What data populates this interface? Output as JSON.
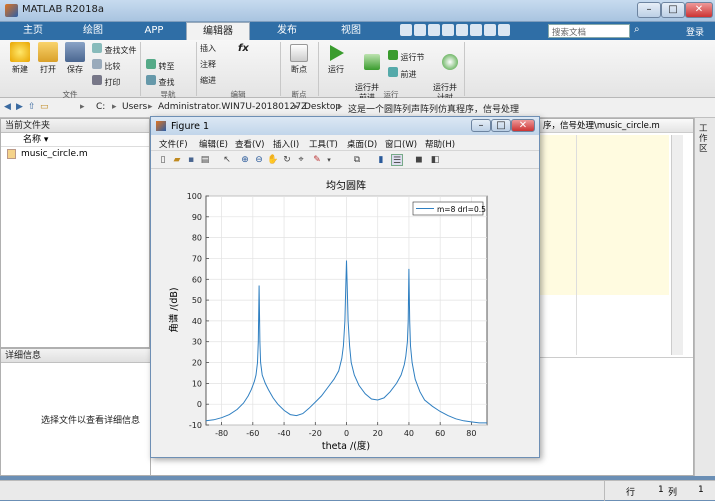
{
  "app": {
    "title": "MATLAB R2018a"
  },
  "tabs": [
    "主页",
    "绘图",
    "APP",
    "编辑器",
    "发布",
    "视图"
  ],
  "search": {
    "placeholder": "搜索文档"
  },
  "login_label": "登录",
  "ribbon": {
    "file": {
      "new": "新建",
      "open": "打开",
      "save": "保存",
      "find_files": "查找文件",
      "compare": "比较",
      "print": "打印",
      "group": "文件"
    },
    "nav": {
      "goto": "转至",
      "find": "查找",
      "group": "导航"
    },
    "edit": {
      "insert": "插入",
      "comment": "注释",
      "indent": "缩进",
      "fx": "fx",
      "group": "编辑"
    },
    "breakpoints": {
      "label": "断点",
      "group": "断点"
    },
    "run": {
      "run": "运行",
      "run_advance": "运行并\n前进",
      "run_section": "运行节",
      "advance": "前进",
      "run_time": "运行并\n计时",
      "group": "运行"
    }
  },
  "address": [
    "C:",
    "Users",
    "Administrator.WIN7U-20180127Z",
    "Desktop",
    "这是一个圆阵列声阵列仿真程序，信号处理"
  ],
  "current_folder": {
    "title": "当前文件夹",
    "col_name": "名称",
    "files": [
      "music_circle.m"
    ]
  },
  "details": {
    "title": "详细信息",
    "message": "选择文件以查看详细信息"
  },
  "editor_tab": "序，信号处理\\music_circle.m",
  "workspace_side": "工作区",
  "status": {
    "row_label": "行",
    "row": "1",
    "col_label": "列",
    "col": "1"
  },
  "figure": {
    "title": "Figure 1",
    "menu": [
      "文件(F)",
      "编辑(E)",
      "查看(V)",
      "插入(I)",
      "工具(T)",
      "桌面(D)",
      "窗口(W)",
      "帮助(H)"
    ]
  },
  "chart_data": {
    "type": "line",
    "title": "均匀圆阵",
    "xlabel": "theta /(度)",
    "ylabel": "角谱 /(dB)",
    "xlim": [
      -90,
      90
    ],
    "ylim": [
      -10,
      100
    ],
    "xticks": [
      -80,
      -60,
      -40,
      -20,
      0,
      20,
      40,
      60,
      80
    ],
    "yticks": [
      -10,
      0,
      10,
      20,
      30,
      40,
      50,
      60,
      70,
      80,
      90,
      100
    ],
    "grid": true,
    "legend_position": "top-right",
    "series": [
      {
        "name": "m=8 drl=0.5",
        "color": "#2f7fc1",
        "x": [
          -90,
          -85,
          -80,
          -75,
          -70,
          -66,
          -63,
          -61,
          -59,
          -58,
          -57,
          -56.5,
          -56,
          -55.5,
          -55,
          -54,
          -52,
          -50,
          -47,
          -44,
          -40,
          -36,
          -32,
          -28,
          -24,
          -20,
          -16,
          -12,
          -8,
          -5,
          -3,
          -2,
          -1,
          -0.5,
          0,
          0.5,
          1,
          2,
          3,
          5,
          8,
          12,
          16,
          20,
          24,
          28,
          32,
          35,
          37,
          38,
          39,
          39.5,
          40,
          40.5,
          41,
          42,
          44,
          47,
          50,
          55,
          60,
          65,
          70,
          75,
          80,
          85,
          90
        ],
        "y": [
          -8,
          -7.5,
          -6.5,
          -5,
          -2.5,
          0.5,
          4,
          7,
          11,
          14,
          20,
          30,
          57,
          30,
          20,
          14,
          10,
          7,
          3,
          0,
          -3,
          -5,
          -5.5,
          -4.5,
          -2,
          1,
          4,
          8,
          12,
          16,
          22,
          28,
          40,
          55,
          69,
          55,
          40,
          28,
          20,
          14,
          9,
          5,
          2.5,
          2,
          3,
          6,
          10,
          14,
          19,
          23,
          30,
          40,
          65,
          40,
          28,
          20,
          12,
          6,
          2,
          -1,
          -3.5,
          -5.5,
          -7,
          -8,
          -8.5,
          -9,
          -9
        ]
      }
    ]
  }
}
